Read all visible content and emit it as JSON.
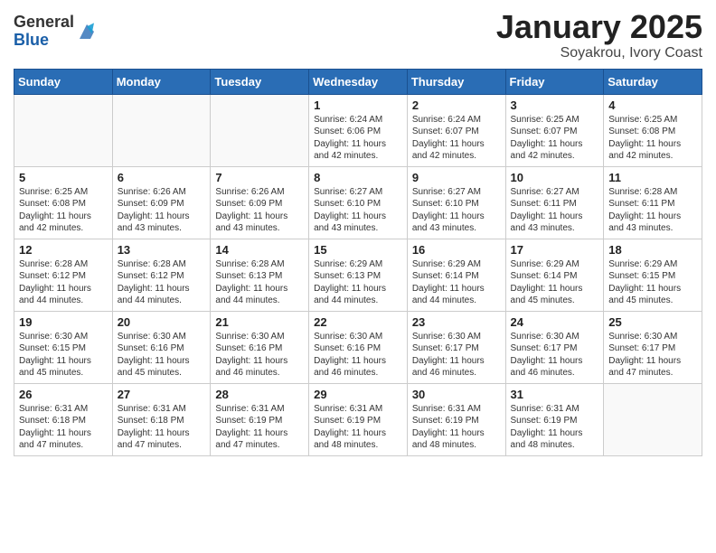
{
  "logo": {
    "general": "General",
    "blue": "Blue"
  },
  "title": "January 2025",
  "subtitle": "Soyakrou, Ivory Coast",
  "days_header": [
    "Sunday",
    "Monday",
    "Tuesday",
    "Wednesday",
    "Thursday",
    "Friday",
    "Saturday"
  ],
  "weeks": [
    [
      {
        "day": "",
        "info": ""
      },
      {
        "day": "",
        "info": ""
      },
      {
        "day": "",
        "info": ""
      },
      {
        "day": "1",
        "info": "Sunrise: 6:24 AM\nSunset: 6:06 PM\nDaylight: 11 hours\nand 42 minutes."
      },
      {
        "day": "2",
        "info": "Sunrise: 6:24 AM\nSunset: 6:07 PM\nDaylight: 11 hours\nand 42 minutes."
      },
      {
        "day": "3",
        "info": "Sunrise: 6:25 AM\nSunset: 6:07 PM\nDaylight: 11 hours\nand 42 minutes."
      },
      {
        "day": "4",
        "info": "Sunrise: 6:25 AM\nSunset: 6:08 PM\nDaylight: 11 hours\nand 42 minutes."
      }
    ],
    [
      {
        "day": "5",
        "info": "Sunrise: 6:25 AM\nSunset: 6:08 PM\nDaylight: 11 hours\nand 42 minutes."
      },
      {
        "day": "6",
        "info": "Sunrise: 6:26 AM\nSunset: 6:09 PM\nDaylight: 11 hours\nand 43 minutes."
      },
      {
        "day": "7",
        "info": "Sunrise: 6:26 AM\nSunset: 6:09 PM\nDaylight: 11 hours\nand 43 minutes."
      },
      {
        "day": "8",
        "info": "Sunrise: 6:27 AM\nSunset: 6:10 PM\nDaylight: 11 hours\nand 43 minutes."
      },
      {
        "day": "9",
        "info": "Sunrise: 6:27 AM\nSunset: 6:10 PM\nDaylight: 11 hours\nand 43 minutes."
      },
      {
        "day": "10",
        "info": "Sunrise: 6:27 AM\nSunset: 6:11 PM\nDaylight: 11 hours\nand 43 minutes."
      },
      {
        "day": "11",
        "info": "Sunrise: 6:28 AM\nSunset: 6:11 PM\nDaylight: 11 hours\nand 43 minutes."
      }
    ],
    [
      {
        "day": "12",
        "info": "Sunrise: 6:28 AM\nSunset: 6:12 PM\nDaylight: 11 hours\nand 44 minutes."
      },
      {
        "day": "13",
        "info": "Sunrise: 6:28 AM\nSunset: 6:12 PM\nDaylight: 11 hours\nand 44 minutes."
      },
      {
        "day": "14",
        "info": "Sunrise: 6:28 AM\nSunset: 6:13 PM\nDaylight: 11 hours\nand 44 minutes."
      },
      {
        "day": "15",
        "info": "Sunrise: 6:29 AM\nSunset: 6:13 PM\nDaylight: 11 hours\nand 44 minutes."
      },
      {
        "day": "16",
        "info": "Sunrise: 6:29 AM\nSunset: 6:14 PM\nDaylight: 11 hours\nand 44 minutes."
      },
      {
        "day": "17",
        "info": "Sunrise: 6:29 AM\nSunset: 6:14 PM\nDaylight: 11 hours\nand 45 minutes."
      },
      {
        "day": "18",
        "info": "Sunrise: 6:29 AM\nSunset: 6:15 PM\nDaylight: 11 hours\nand 45 minutes."
      }
    ],
    [
      {
        "day": "19",
        "info": "Sunrise: 6:30 AM\nSunset: 6:15 PM\nDaylight: 11 hours\nand 45 minutes."
      },
      {
        "day": "20",
        "info": "Sunrise: 6:30 AM\nSunset: 6:16 PM\nDaylight: 11 hours\nand 45 minutes."
      },
      {
        "day": "21",
        "info": "Sunrise: 6:30 AM\nSunset: 6:16 PM\nDaylight: 11 hours\nand 46 minutes."
      },
      {
        "day": "22",
        "info": "Sunrise: 6:30 AM\nSunset: 6:16 PM\nDaylight: 11 hours\nand 46 minutes."
      },
      {
        "day": "23",
        "info": "Sunrise: 6:30 AM\nSunset: 6:17 PM\nDaylight: 11 hours\nand 46 minutes."
      },
      {
        "day": "24",
        "info": "Sunrise: 6:30 AM\nSunset: 6:17 PM\nDaylight: 11 hours\nand 46 minutes."
      },
      {
        "day": "25",
        "info": "Sunrise: 6:30 AM\nSunset: 6:17 PM\nDaylight: 11 hours\nand 47 minutes."
      }
    ],
    [
      {
        "day": "26",
        "info": "Sunrise: 6:31 AM\nSunset: 6:18 PM\nDaylight: 11 hours\nand 47 minutes."
      },
      {
        "day": "27",
        "info": "Sunrise: 6:31 AM\nSunset: 6:18 PM\nDaylight: 11 hours\nand 47 minutes."
      },
      {
        "day": "28",
        "info": "Sunrise: 6:31 AM\nSunset: 6:19 PM\nDaylight: 11 hours\nand 47 minutes."
      },
      {
        "day": "29",
        "info": "Sunrise: 6:31 AM\nSunset: 6:19 PM\nDaylight: 11 hours\nand 48 minutes."
      },
      {
        "day": "30",
        "info": "Sunrise: 6:31 AM\nSunset: 6:19 PM\nDaylight: 11 hours\nand 48 minutes."
      },
      {
        "day": "31",
        "info": "Sunrise: 6:31 AM\nSunset: 6:19 PM\nDaylight: 11 hours\nand 48 minutes."
      },
      {
        "day": "",
        "info": ""
      }
    ]
  ]
}
